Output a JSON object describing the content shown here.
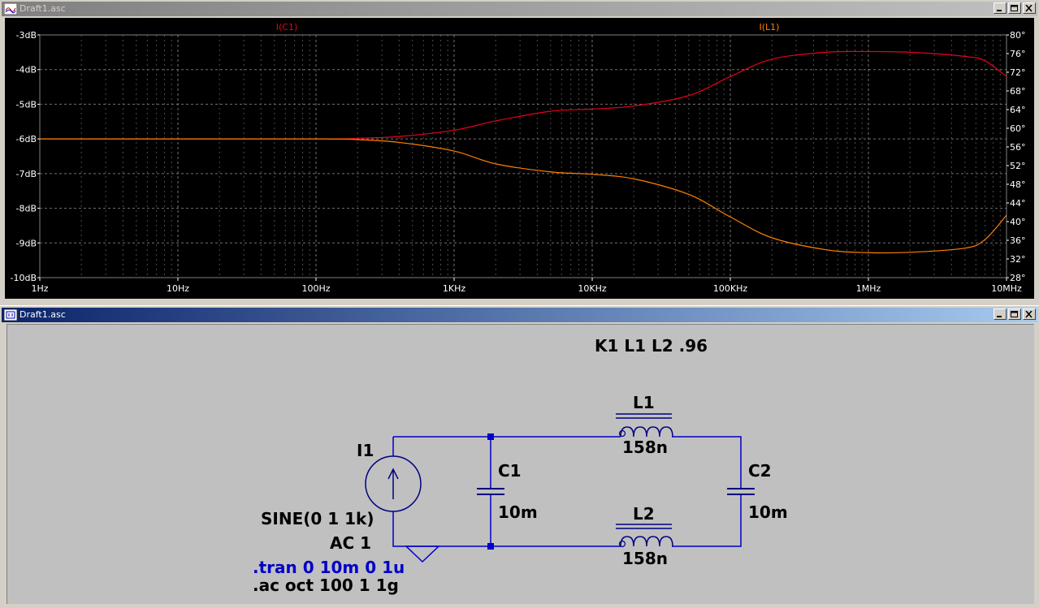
{
  "plot_window": {
    "title": "Draft1.asc",
    "buttons": {
      "minimize": "_",
      "maximize": "□",
      "close": "×"
    }
  },
  "schematic_window": {
    "title": "Draft1.asc",
    "buttons": {
      "minimize": "_",
      "maximize": "□",
      "close": "×"
    }
  },
  "colors": {
    "trace_ic1": "#e8001c",
    "trace_il1": "#ff8000",
    "wire": "#0000c8",
    "plot_bg": "#000000",
    "grid": "#808080",
    "tick_text": "#ffffff",
    "directive_blue": "#0000c8"
  },
  "chart_data": {
    "type": "line",
    "x_scale": "log",
    "x_ticks": [
      "1Hz",
      "10Hz",
      "100Hz",
      "1KHz",
      "10KHz",
      "100KHz",
      "1MHz",
      "10MHz"
    ],
    "x_range": [
      1,
      10000000
    ],
    "left_axis": {
      "unit": "dB",
      "range": [
        -10,
        -3
      ],
      "ticks": [
        "-3dB",
        "-4dB",
        "-5dB",
        "-6dB",
        "-7dB",
        "-8dB",
        "-9dB",
        "-10dB"
      ]
    },
    "right_axis": {
      "unit": "°",
      "range": [
        28,
        80
      ],
      "ticks": [
        "80°",
        "76°",
        "72°",
        "68°",
        "64°",
        "60°",
        "56°",
        "52°",
        "48°",
        "44°",
        "40°",
        "36°",
        "32°",
        "28°"
      ]
    },
    "grid": true,
    "series": [
      {
        "name": "I(C1)",
        "color": "#e8001c",
        "x": [
          1,
          100,
          200,
          400,
          1000,
          2000,
          5000,
          10000,
          20000,
          50000,
          100000,
          200000,
          500000,
          1000000,
          2000000,
          5000000,
          7000000,
          10000000
        ],
        "y": [
          -6.0,
          -6.0,
          -5.98,
          -5.93,
          -5.75,
          -5.48,
          -5.2,
          -5.14,
          -5.05,
          -4.75,
          -4.2,
          -3.7,
          -3.5,
          -3.48,
          -3.5,
          -3.62,
          -3.75,
          -4.2
        ]
      },
      {
        "name": "I(L1)",
        "color": "#ff8000",
        "x": [
          1,
          100,
          200,
          400,
          1000,
          2000,
          5000,
          10000,
          20000,
          50000,
          100000,
          200000,
          500000,
          1000000,
          2000000,
          5000000,
          7000000,
          10000000
        ],
        "y": [
          -6.0,
          -6.0,
          -6.02,
          -6.1,
          -6.35,
          -6.72,
          -6.95,
          -7.02,
          -7.15,
          -7.6,
          -8.25,
          -8.85,
          -9.2,
          -9.28,
          -9.27,
          -9.15,
          -8.9,
          -8.2
        ]
      }
    ]
  },
  "schematic": {
    "directive_k": "K1 L1 L2 .96",
    "source_name": "I1",
    "source_value": "SINE(0 1 1k)",
    "source_ac": "AC 1",
    "tran": ".tran 0 10m 0 1u",
    "ac": ".ac oct 100 1 1g",
    "c1_name": "C1",
    "c1_value": "10m",
    "c2_name": "C2",
    "c2_value": "10m",
    "l1_name": "L1",
    "l1_value": "158n",
    "l2_name": "L2",
    "l2_value": "158n"
  }
}
